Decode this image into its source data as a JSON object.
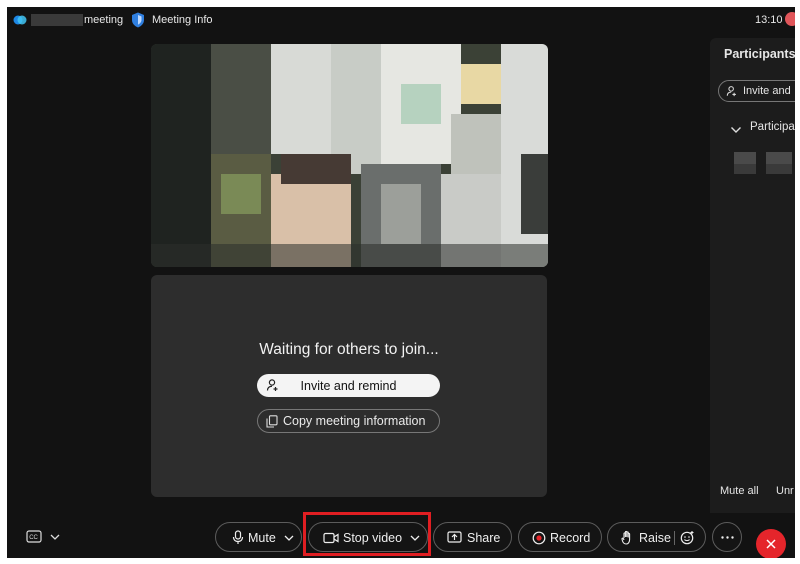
{
  "titlebar": {
    "title": "meeting",
    "meeting_info_label": "Meeting Info",
    "time": "13:10",
    "accent": "#e0565a"
  },
  "stage": {
    "waiting_text": "Waiting for others to join...",
    "invite_label": "Invite and remind",
    "copy_label": "Copy meeting information"
  },
  "participants": {
    "title": "Participants",
    "invite_label": "Invite and",
    "group_label": "Participa",
    "mute_all_label": "Mute all",
    "unmute_all_label": "Unr"
  },
  "controls": {
    "mute_label": "Mute",
    "stop_video_label": "Stop video",
    "share_label": "Share",
    "record_label": "Record",
    "raise_label": "Raise",
    "highlight_color": "#e01e22",
    "leave_color": "#e5252b"
  },
  "icons": [
    "webex-logo-icon",
    "shield-icon",
    "person-add-icon",
    "copy-icon",
    "chevron-down-icon",
    "closed-captions-icon",
    "microphone-icon",
    "camera-icon",
    "share-screen-icon",
    "record-icon",
    "raise-hand-icon",
    "reactions-icon",
    "more-icon",
    "leave-icon"
  ]
}
